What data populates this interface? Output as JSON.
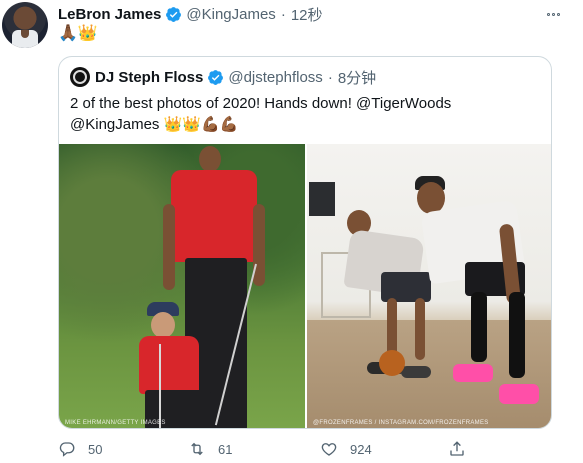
{
  "tweet": {
    "author_name": "LeBron James",
    "author_handle": "@KingJames",
    "separator": "·",
    "time": "12秒",
    "emojis": "🙏🏾👑",
    "verified": true
  },
  "quote": {
    "author_name": "DJ Steph Floss",
    "author_handle": "@djstephfloss",
    "separator": "·",
    "time": "8分钟",
    "text_line1": "2 of the best photos of 2020! Hands down! @TigerWoods",
    "text_line2": "@KingJames 👑👑💪🏾💪🏾"
  },
  "photos": [
    {
      "alt": "Tiger Woods and son on golf course",
      "credit": "MIKE EHRMANN/GETTY IMAGES"
    },
    {
      "alt": "LeBron James and son on basketball court",
      "credit": "@FROZENFRAMES / INSTAGRAM.COM/FROZENFRAMES"
    }
  ],
  "actions": {
    "reply_count": "50",
    "retweet_count": "61",
    "like_count": "924"
  },
  "colors": {
    "verified_blue": "#1d9bf0",
    "secondary_text": "#536471",
    "border": "#cfd9de"
  },
  "icons": [
    "more-options-icon",
    "verified-badge-icon",
    "reply-icon",
    "retweet-icon",
    "like-icon",
    "share-icon"
  ]
}
